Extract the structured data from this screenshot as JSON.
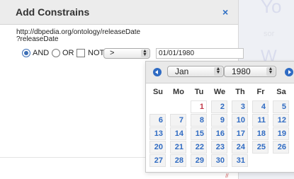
{
  "dialog": {
    "title": "Add Constrains",
    "close_label": "×",
    "uri_line1": "http://dbpedia.org/ontology/releaseDate",
    "uri_line2": "?releaseDate"
  },
  "controls": {
    "and_label": "AND",
    "or_label": "OR",
    "not_label": "NOT",
    "operator_value": ">",
    "date_value": "01/01/1980",
    "selected_logic": "AND"
  },
  "background": {
    "text_1": "Yo",
    "text_2": "sor",
    "text_3": "W"
  },
  "datepicker": {
    "month": "Jan",
    "year": "1980",
    "weekdays": [
      "Su",
      "Mo",
      "Tu",
      "We",
      "Th",
      "Fr",
      "Sa"
    ],
    "weeks": [
      [
        "",
        "",
        "1",
        "2",
        "3",
        "4",
        "5"
      ],
      [
        "6",
        "7",
        "8",
        "9",
        "10",
        "11",
        "12"
      ],
      [
        "13",
        "14",
        "15",
        "16",
        "17",
        "18",
        "19"
      ],
      [
        "20",
        "21",
        "22",
        "23",
        "24",
        "25",
        "26"
      ],
      [
        "27",
        "28",
        "29",
        "30",
        "31",
        "",
        ""
      ]
    ],
    "highlighted_day": "1",
    "colors": {
      "accent": "#2f6bc3",
      "highlight": "#c23a4a"
    }
  }
}
